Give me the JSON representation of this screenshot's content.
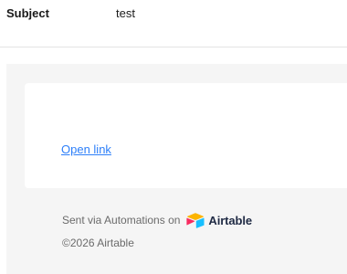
{
  "email": {
    "subject_label": "Subject",
    "subject_value": "test"
  },
  "body": {
    "link_text": "Open link"
  },
  "footer": {
    "sent_via_text": "Sent via Automations on",
    "brand_name": "Airtable",
    "copyright": "©2026 Airtable"
  },
  "colors": {
    "link": "#2d7ff9",
    "frame_bg": "#f5f5f5",
    "logo_yellow": "#fcb400",
    "logo_blue": "#18bfff",
    "logo_red": "#f82b60"
  },
  "icons": {
    "brand_logo": "airtable-logo-icon"
  }
}
